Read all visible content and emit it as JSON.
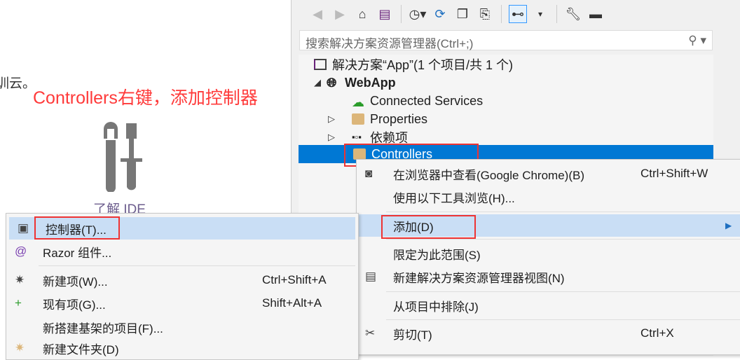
{
  "background": {
    "partial_text": "训云。",
    "annotation": "Controllers右键，添加控制器",
    "learn_ide": "了解 IDE",
    "annotation_color": "#ff3a3a"
  },
  "toolbar": {
    "icons": [
      "back-icon",
      "forward-icon",
      "home-icon",
      "vs-solution-icon",
      "history-icon",
      "sync-icon",
      "collapse-icon",
      "copy-icon",
      "tree-view-icon",
      "wrench-icon",
      "minus-icon"
    ]
  },
  "search": {
    "placeholder": "搜索解决方案资源管理器(Ctrl+;)"
  },
  "tree": {
    "solution": "解决方案“App”(1 个项目/共 1 个)",
    "project": "WebApp",
    "items": [
      "Connected Services",
      "Properties",
      "依赖项",
      "Controllers"
    ]
  },
  "context_menu": {
    "items": [
      {
        "label": "在浏览器中查看(Google Chrome)(B)",
        "shortcut": "Ctrl+Shift+W"
      },
      {
        "label": "使用以下工具浏览(H)..."
      },
      {
        "label": "添加(D)"
      },
      {
        "label": "限定为此范围(S)"
      },
      {
        "label": "新建解决方案资源管理器视图(N)"
      },
      {
        "label": "从项目中排除(J)"
      },
      {
        "label": "剪切(T)",
        "shortcut": "Ctrl+X"
      }
    ]
  },
  "add_submenu": {
    "items": [
      {
        "label": "控制器(T)..."
      },
      {
        "label": "Razor 组件..."
      },
      {
        "label": "新建项(W)...",
        "shortcut": "Ctrl+Shift+A"
      },
      {
        "label": "现有项(G)...",
        "shortcut": "Shift+Alt+A"
      },
      {
        "label": "新搭建基架的项目(F)..."
      },
      {
        "label": "新建文件夹(D)"
      }
    ]
  },
  "colors": {
    "selection": "#0078d4",
    "menu_highlight": "#c9def5",
    "highlight_box": "#ee3333"
  }
}
